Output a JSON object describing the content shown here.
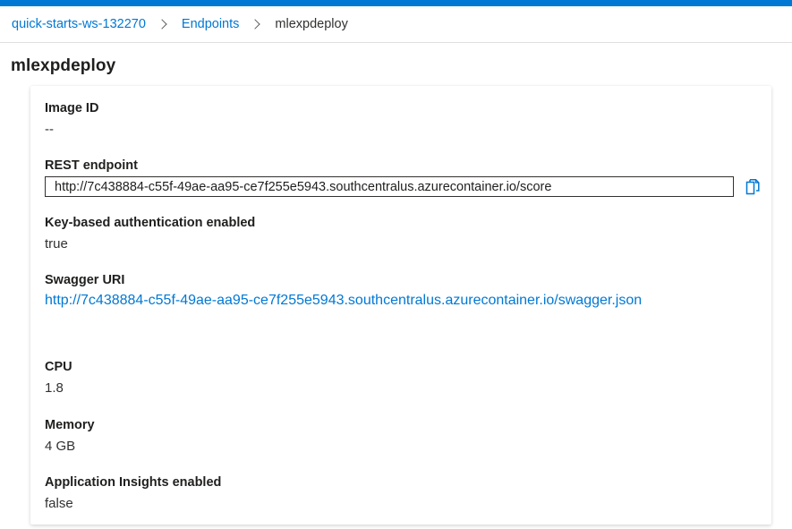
{
  "breadcrumb": {
    "workspace": "quick-starts-ws-132270",
    "section": "Endpoints",
    "current": "mlexpdeploy"
  },
  "page": {
    "title": "mlexpdeploy"
  },
  "details": {
    "image_id": {
      "label": "Image ID",
      "value": "--"
    },
    "rest_endpoint": {
      "label": "REST endpoint",
      "value": "http://7c438884-c55f-49ae-aa95-ce7f255e5943.southcentralus.azurecontainer.io/score",
      "copy_icon": "copy-icon"
    },
    "key_auth": {
      "label": "Key-based authentication enabled",
      "value": "true"
    },
    "swagger": {
      "label": "Swagger URI",
      "value": "http://7c438884-c55f-49ae-aa95-ce7f255e5943.southcentralus.azurecontainer.io/swagger.json"
    },
    "cpu": {
      "label": "CPU",
      "value": "1.8"
    },
    "memory": {
      "label": "Memory",
      "value": "4 GB"
    },
    "app_insights": {
      "label": "Application Insights enabled",
      "value": "false"
    }
  },
  "colors": {
    "accent": "#0078d4",
    "text": "#323130"
  }
}
